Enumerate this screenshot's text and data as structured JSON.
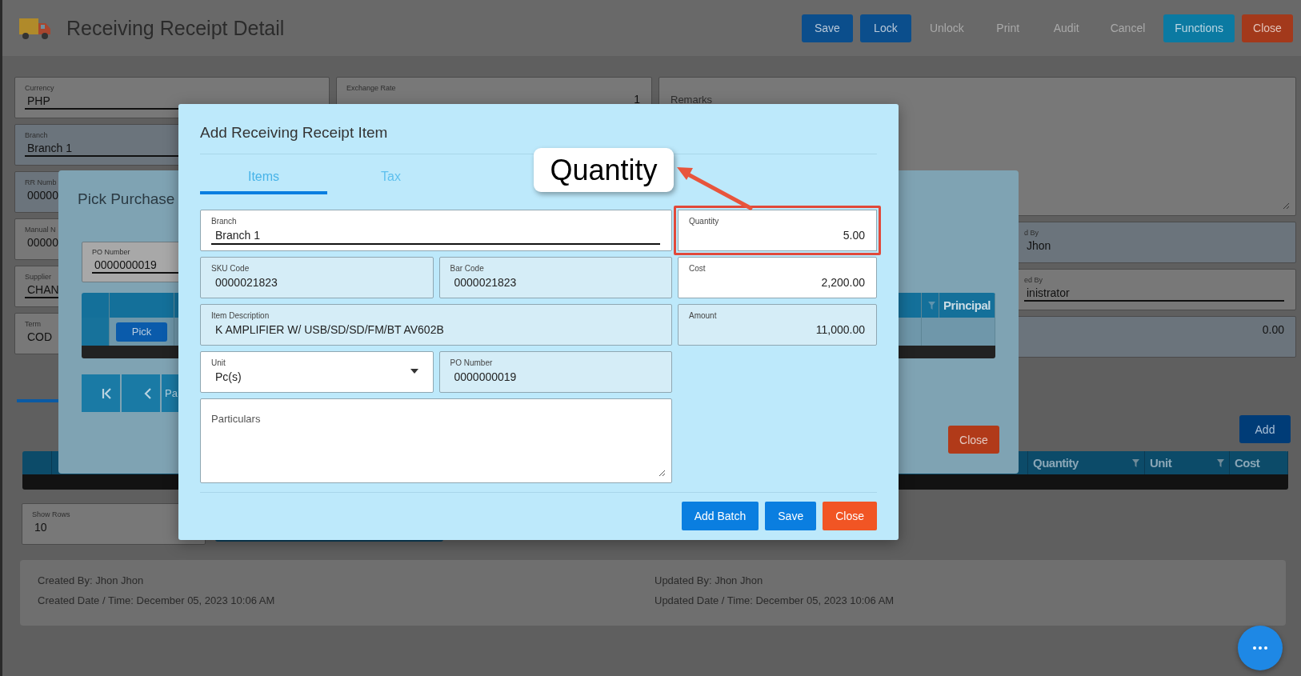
{
  "header": {
    "title": "Receiving Receipt Detail",
    "buttons": [
      {
        "label": "Save",
        "kind": "primary",
        "disabled": false
      },
      {
        "label": "Lock",
        "kind": "primary",
        "disabled": false
      },
      {
        "label": "Unlock",
        "kind": "primary",
        "disabled": true
      },
      {
        "label": "Print",
        "kind": "primary",
        "disabled": true
      },
      {
        "label": "Audit",
        "kind": "primary",
        "disabled": true
      },
      {
        "label": "Cancel",
        "kind": "primary",
        "disabled": true
      },
      {
        "label": "Functions",
        "kind": "info",
        "disabled": false
      },
      {
        "label": "Close",
        "kind": "danger",
        "disabled": false
      }
    ]
  },
  "form": {
    "left_fields": [
      {
        "label": "Currency",
        "value": "PHP",
        "kind": "select"
      },
      {
        "label": "Branch",
        "value": "Branch 1",
        "kind": "locked_select"
      },
      {
        "label": "RR Numb",
        "value": "00000",
        "kind": "locked"
      },
      {
        "label": "Manual N",
        "value": "00000",
        "kind": "input"
      },
      {
        "label": "Supplier",
        "value": "CHAN",
        "kind": "select"
      },
      {
        "label": "Term",
        "value": "COD",
        "kind": "input"
      }
    ],
    "exchange_rate": {
      "label": "Exchange Rate",
      "value": "1"
    },
    "remarks": {
      "label": "Remarks"
    },
    "right_fields": [
      {
        "label": "d By",
        "value": "Jhon",
        "kind": "locked"
      },
      {
        "label": "ed By",
        "value": "inistrator",
        "kind": "select"
      },
      {
        "value": "0.00",
        "kind": "locked"
      }
    ]
  },
  "details": {
    "add_button": "Add",
    "table": {
      "columns": [
        {
          "label": "Quantity"
        },
        {
          "label": "Unit"
        },
        {
          "label": "Cost"
        }
      ]
    },
    "show_rows": {
      "label": "Show Rows",
      "value": "10"
    }
  },
  "footer": {
    "created_by": "Created By: Jhon Jhon",
    "created_date": "Created Date / Time: December 05, 2023 10:06 AM",
    "updated_by": "Updated By: Jhon Jhon",
    "updated_date": "Updated Date / Time: December 05, 2023 10:06 AM"
  },
  "pick_modal": {
    "title": "Pick Purchase",
    "po_field": {
      "label": "PO Number",
      "value": "0000000019"
    },
    "table": {
      "columns": [
        {
          "label": "Principal"
        }
      ],
      "rows": [
        {
          "action": "Pick"
        }
      ]
    },
    "pagination": [
      {
        "kind": "first"
      },
      {
        "kind": "prev"
      },
      {
        "kind": "page",
        "label": "Pa"
      }
    ],
    "close": "Close"
  },
  "add_modal": {
    "title": "Add Receiving Receipt Item",
    "tabs": [
      {
        "label": "Items",
        "selected": true
      },
      {
        "label": "Tax",
        "selected": false
      }
    ],
    "main_rows": [
      [
        {
          "label": "Branch",
          "value": "Branch 1",
          "kind": "select"
        }
      ],
      [
        {
          "label": "SKU Code",
          "value": "0000021823",
          "kind": "readonly"
        },
        {
          "label": "Bar Code",
          "value": "0000021823",
          "kind": "readonly"
        }
      ],
      [
        {
          "label": "Item Description",
          "value": "K AMPLIFIER W/ USB/SD/SD/FM/BT AV602B",
          "kind": "readonly"
        }
      ],
      [
        {
          "label": "Unit",
          "value": "Pc(s)",
          "kind": "dropdown"
        },
        {
          "label": "PO Number",
          "value": "0000000019",
          "kind": "readonly"
        }
      ],
      [
        {
          "label": "Particulars",
          "kind": "textarea"
        }
      ]
    ],
    "side_fields": [
      {
        "label": "Quantity",
        "value": "5.00",
        "kind": "number",
        "highlighted": true
      },
      {
        "label": "Cost",
        "value": "2,200.00",
        "kind": "number",
        "highlighted": false
      },
      {
        "label": "Amount",
        "value": "11,000.00",
        "kind": "number_readonly",
        "highlighted": false
      }
    ],
    "buttons": [
      {
        "label": "Add Batch",
        "kind": "primary"
      },
      {
        "label": "Save",
        "kind": "primary"
      },
      {
        "label": "Close",
        "kind": "danger"
      }
    ]
  },
  "annotation": {
    "label": "Quantity"
  }
}
